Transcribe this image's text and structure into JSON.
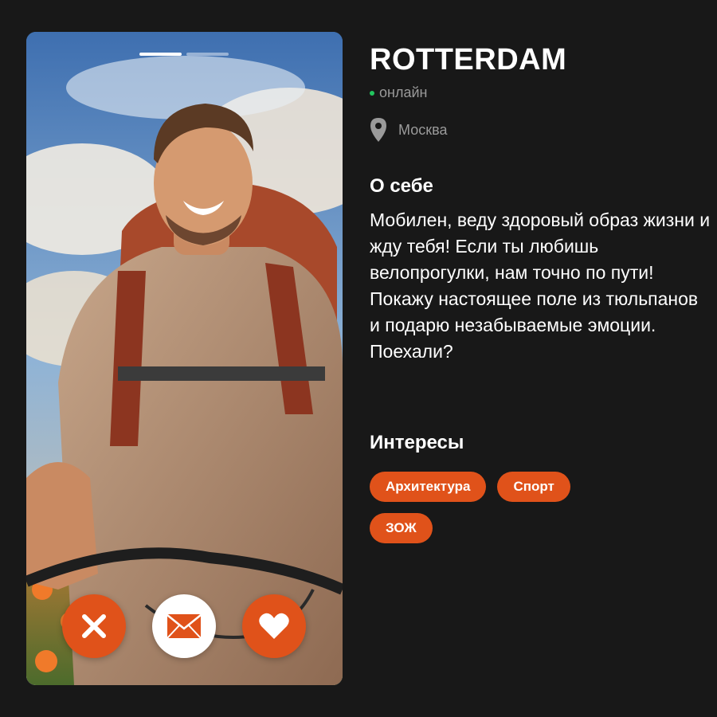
{
  "card": {
    "progress_segments": 2,
    "active_segment": 1
  },
  "actions": {
    "dislike_icon": "close-icon",
    "message_icon": "envelope-icon",
    "like_icon": "heart-icon"
  },
  "profile": {
    "username": "ROTTERDAM",
    "status": "онлайн",
    "location": "Москва"
  },
  "about": {
    "title": "О себе",
    "text": "Мобилен, веду здоровый образ жизни и жду тебя! Если ты любишь велопрогулки, нам точно по пути! Покажу настоящее поле из тюльпанов и подарю незабываемые эмоции. Поехали?"
  },
  "interests": {
    "title": "Интересы",
    "tags": [
      "Архитектура",
      "Спорт",
      "ЗОЖ"
    ]
  },
  "colors": {
    "background": "#181818",
    "accent": "#e0521a",
    "online": "#22c55e",
    "muted": "#9a9a9a"
  }
}
